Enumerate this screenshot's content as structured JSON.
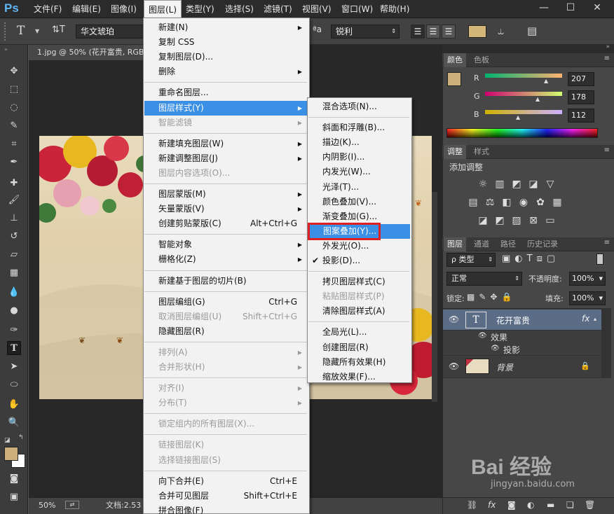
{
  "app": {
    "logo": "Ps"
  },
  "menubar": {
    "items": [
      "文件(F)",
      "编辑(E)",
      "图像(I)",
      "图层(L)",
      "类型(Y)",
      "选择(S)",
      "滤镜(T)",
      "视图(V)",
      "窗口(W)",
      "帮助(H)"
    ],
    "window_controls": [
      "—",
      "☐",
      "✕"
    ]
  },
  "options": {
    "tool_icon": "T",
    "orient_icon": "⇅T",
    "font_family": "华文琥珀",
    "aa_label": "ªa",
    "aa_mode": "锐利",
    "align_icons": [
      "align-left-icon",
      "align-center-icon",
      "align-right-icon"
    ],
    "text_color": "#d4b67a",
    "warp_icon": "warp-text-icon",
    "panels_icon": "character-panel-icon"
  },
  "document": {
    "tab_title": "1.jpg @ 50% (花开富贵, RGB",
    "zoom": "50%",
    "doc_info": "文档:2.53"
  },
  "layer_menu": {
    "groups": [
      [
        {
          "label": "新建(N)",
          "submenu": true
        },
        {
          "label": "复制 CSS"
        },
        {
          "label": "复制图层(D)..."
        },
        {
          "label": "删除",
          "submenu": true
        }
      ],
      [
        {
          "label": "重命名图层..."
        },
        {
          "label": "图层样式(Y)",
          "submenu": true,
          "highlighted": true
        },
        {
          "label": "智能滤镜",
          "submenu": true,
          "disabled": true
        }
      ],
      [
        {
          "label": "新建填充图层(W)",
          "submenu": true
        },
        {
          "label": "新建调整图层(J)",
          "submenu": true
        },
        {
          "label": "图层内容选项(O)...",
          "disabled": true
        }
      ],
      [
        {
          "label": "图层蒙版(M)",
          "submenu": true
        },
        {
          "label": "矢量蒙版(V)",
          "submenu": true
        },
        {
          "label": "创建剪贴蒙版(C)",
          "shortcut": "Alt+Ctrl+G"
        }
      ],
      [
        {
          "label": "智能对象",
          "submenu": true
        },
        {
          "label": "栅格化(Z)",
          "submenu": true
        }
      ],
      [
        {
          "label": "新建基于图层的切片(B)"
        }
      ],
      [
        {
          "label": "图层编组(G)",
          "shortcut": "Ctrl+G"
        },
        {
          "label": "取消图层编组(U)",
          "shortcut": "Shift+Ctrl+G",
          "disabled": true
        },
        {
          "label": "隐藏图层(R)"
        }
      ],
      [
        {
          "label": "排列(A)",
          "submenu": true,
          "disabled": true
        },
        {
          "label": "合并形状(H)",
          "submenu": true,
          "disabled": true
        }
      ],
      [
        {
          "label": "对齐(I)",
          "submenu": true,
          "disabled": true
        },
        {
          "label": "分布(T)",
          "submenu": true,
          "disabled": true
        }
      ],
      [
        {
          "label": "锁定组内的所有图层(X)...",
          "disabled": true
        }
      ],
      [
        {
          "label": "链接图层(K)",
          "disabled": true
        },
        {
          "label": "选择链接图层(S)",
          "disabled": true
        }
      ],
      [
        {
          "label": "向下合并(E)",
          "shortcut": "Ctrl+E"
        },
        {
          "label": "合并可见图层",
          "shortcut": "Shift+Ctrl+E"
        },
        {
          "label": "拼合图像(F)"
        }
      ]
    ]
  },
  "style_submenu": {
    "groups": [
      [
        {
          "label": "混合选项(N)..."
        }
      ],
      [
        {
          "label": "斜面和浮雕(B)..."
        },
        {
          "label": "描边(K)..."
        },
        {
          "label": "内阴影(I)..."
        },
        {
          "label": "内发光(W)..."
        },
        {
          "label": "光泽(T)..."
        },
        {
          "label": "颜色叠加(V)..."
        },
        {
          "label": "渐变叠加(G)..."
        },
        {
          "label": "图案叠加(Y)...",
          "highlighted": true,
          "boxed": true
        },
        {
          "label": "外发光(O)..."
        },
        {
          "label": "投影(D)...",
          "checked": true
        }
      ],
      [
        {
          "label": "拷贝图层样式(C)"
        },
        {
          "label": "粘贴图层样式(P)",
          "disabled": true
        },
        {
          "label": "清除图层样式(A)"
        }
      ],
      [
        {
          "label": "全局光(L)..."
        },
        {
          "label": "创建图层(R)"
        },
        {
          "label": "隐藏所有效果(H)"
        },
        {
          "label": "缩放效果(F)..."
        }
      ]
    ],
    "highlight_box_color": "#e02020"
  },
  "color_panel": {
    "tabs": [
      "颜色",
      "色板"
    ],
    "fg_color": "#cfb07a",
    "channels": [
      {
        "name": "R",
        "value": "207"
      },
      {
        "name": "G",
        "value": "178"
      },
      {
        "name": "B",
        "value": "112"
      }
    ]
  },
  "adjustments_panel": {
    "tabs": [
      "调整",
      "样式"
    ],
    "title": "添加调整"
  },
  "layers_panel": {
    "tabs": [
      "图层",
      "通道",
      "路径",
      "历史记录"
    ],
    "filter_label": "类型",
    "blend_mode": "正常",
    "opacity_label": "不透明度:",
    "opacity_value": "100%",
    "lock_label": "锁定:",
    "fill_label": "填充:",
    "fill_value": "100%",
    "layers": [
      {
        "name": "花开富贵",
        "kind": "text",
        "fx": "fx",
        "selected": true
      },
      {
        "name": "效果",
        "kind": "effects"
      },
      {
        "name": "投影",
        "kind": "effect-item"
      },
      {
        "name": "背景",
        "kind": "background",
        "locked": true
      }
    ]
  },
  "watermark": {
    "text": "Bai 经验",
    "url": "jingyan.baidu.com"
  }
}
